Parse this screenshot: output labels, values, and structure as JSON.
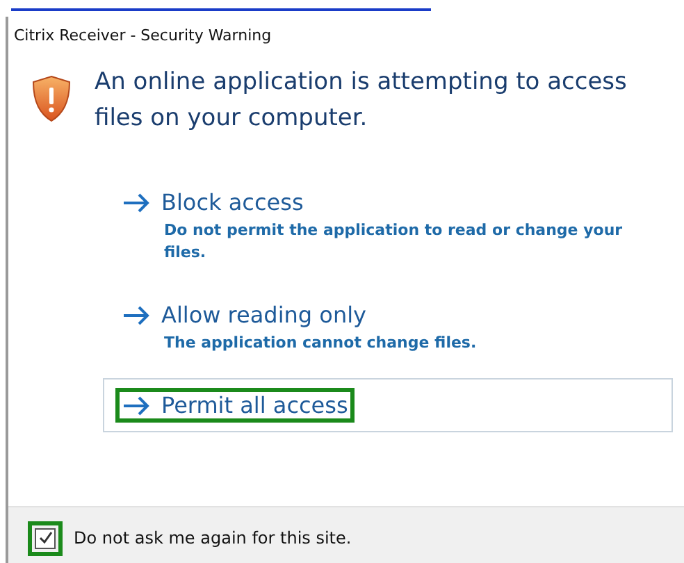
{
  "window": {
    "title": "Citrix Receiver - Security Warning"
  },
  "heading": "An online application is attempting to access files on your computer.",
  "options": [
    {
      "label": "Block access",
      "description": "Do not permit the application to read or change your files.",
      "selected": false,
      "highlighted": false
    },
    {
      "label": "Allow reading only",
      "description": "The application cannot change files.",
      "selected": false,
      "highlighted": false
    },
    {
      "label": "Permit all access",
      "selected": true,
      "highlighted": true
    }
  ],
  "remember": {
    "label": "Do not ask me again for this site.",
    "checked": true,
    "highlighted": true
  }
}
